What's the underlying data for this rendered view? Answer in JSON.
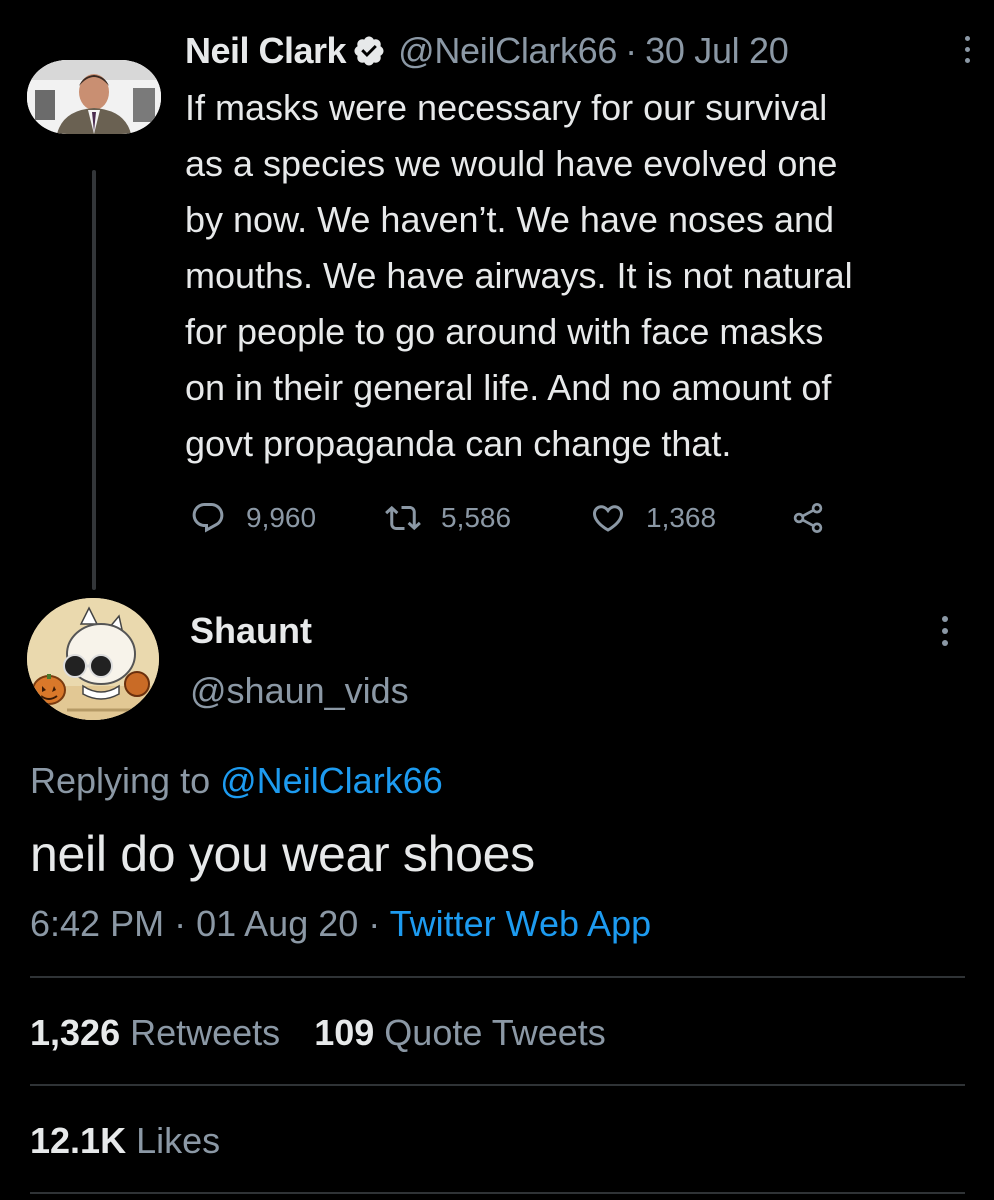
{
  "parent_tweet": {
    "author_name": "Neil Clark",
    "handle": "@NeilClark66",
    "separator": "·",
    "date": "30 Jul 20",
    "text_lines": [
      "If masks were necessary for our survival",
      "as a species we would have evolved one",
      "by now. We haven’t. We have noses and",
      "mouths. We have airways. It is not natural",
      "for people to go around with face masks",
      "on in their general life. And no amount of",
      "govt propaganda can change that."
    ],
    "actions": {
      "replies": "9,960",
      "retweets": "5,586",
      "likes": "1,368"
    }
  },
  "reply_tweet": {
    "author_name": "Shaunt",
    "handle": "@shaun_vids",
    "replying_prefix": "Replying to",
    "replying_to": "@NeilClark66",
    "text": "neil do you wear shoes",
    "time": "6:42 PM",
    "separator": "·",
    "date": "01 Aug 20",
    "source": "Twitter Web App",
    "stats": {
      "retweets_count": "1,326",
      "retweets_label": "Retweets",
      "quotes_count": "109",
      "quotes_label": "Quote Tweets",
      "likes_count": "12.1K",
      "likes_label": "Likes"
    }
  },
  "icons": {
    "verified": "verified-badge-icon",
    "more": "more-vertical-icon",
    "reply": "reply-bubble-icon",
    "retweet": "retweet-icon",
    "like": "heart-icon",
    "share": "share-icon"
  },
  "colors": {
    "background": "#000000",
    "text_primary": "#e7e9ea",
    "text_secondary": "#8b98a5",
    "accent": "#1d9bf0",
    "divider": "#2f3336"
  }
}
